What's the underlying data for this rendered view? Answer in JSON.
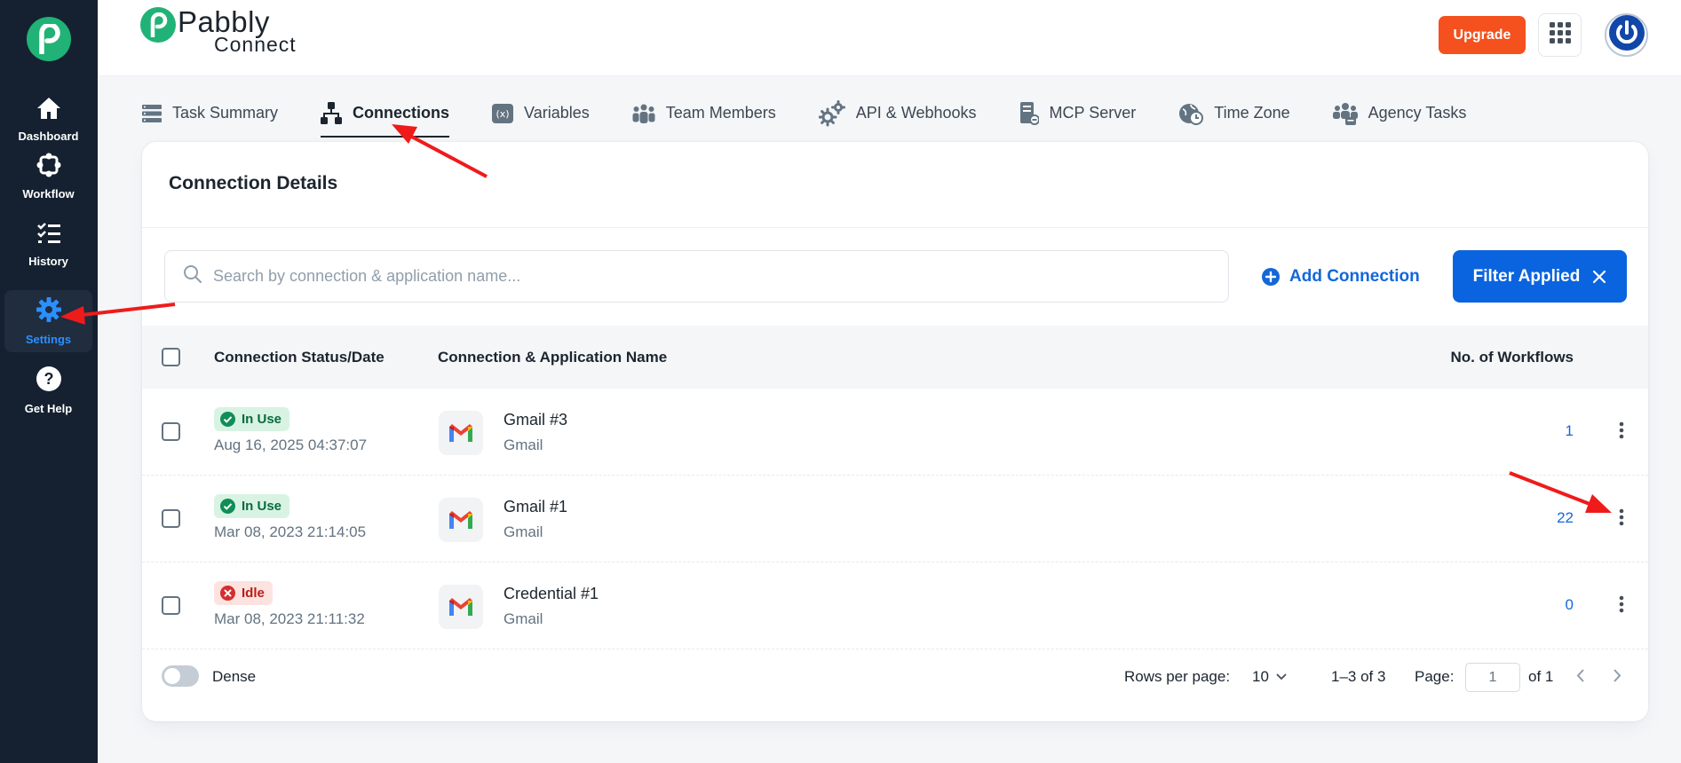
{
  "sidebar": {
    "items": [
      {
        "label": "Dashboard",
        "icon": "home-icon"
      },
      {
        "label": "Workflow",
        "icon": "workflow-icon"
      },
      {
        "label": "History",
        "icon": "history-icon"
      },
      {
        "label": "Settings",
        "icon": "gear-icon",
        "active": true
      },
      {
        "label": "Get Help",
        "icon": "help-icon"
      }
    ]
  },
  "header": {
    "logo_line1": "Pabbly",
    "logo_line2": "Connect",
    "upgrade_label": "Upgrade"
  },
  "tabs": [
    {
      "label": "Task Summary",
      "icon": "task-summary-icon"
    },
    {
      "label": "Connections",
      "icon": "connections-icon",
      "active": true
    },
    {
      "label": "Variables",
      "icon": "variables-icon"
    },
    {
      "label": "Team Members",
      "icon": "team-icon"
    },
    {
      "label": "API & Webhooks",
      "icon": "gears-icon"
    },
    {
      "label": "MCP Server",
      "icon": "mcp-server-icon"
    },
    {
      "label": "Time Zone",
      "icon": "time-zone-icon"
    },
    {
      "label": "Agency Tasks",
      "icon": "agency-icon"
    }
  ],
  "card": {
    "title": "Connection Details",
    "search_placeholder": "Search by connection & application name...",
    "add_connection_label": "Add Connection",
    "filter_label": "Filter Applied"
  },
  "table": {
    "columns": {
      "status": "Connection Status/Date",
      "name": "Connection & Application Name",
      "workflows": "No. of Workflows"
    },
    "rows": [
      {
        "status": "In Use",
        "date": "Aug 16, 2025 04:37:07",
        "name": "Gmail #3",
        "app": "Gmail",
        "workflows": "1"
      },
      {
        "status": "In Use",
        "date": "Mar 08, 2023 21:14:05",
        "name": "Gmail #1",
        "app": "Gmail",
        "workflows": "22"
      },
      {
        "status": "Idle",
        "date": "Mar 08, 2023 21:11:32",
        "name": "Credential #1",
        "app": "Gmail",
        "workflows": "0"
      }
    ]
  },
  "footer": {
    "dense_label": "Dense",
    "rows_per_page_label": "Rows per page:",
    "rows_per_page_value": "10",
    "range": "1–3 of 3",
    "page_label": "Page:",
    "page_value": "1",
    "page_total": "of 1"
  },
  "colors": {
    "sidebar_bg": "#152130",
    "brand_green": "#20b276",
    "accent_blue": "#0b64df",
    "upgrade_orange": "#f4511e",
    "annotation_red": "#ef1b1b"
  }
}
